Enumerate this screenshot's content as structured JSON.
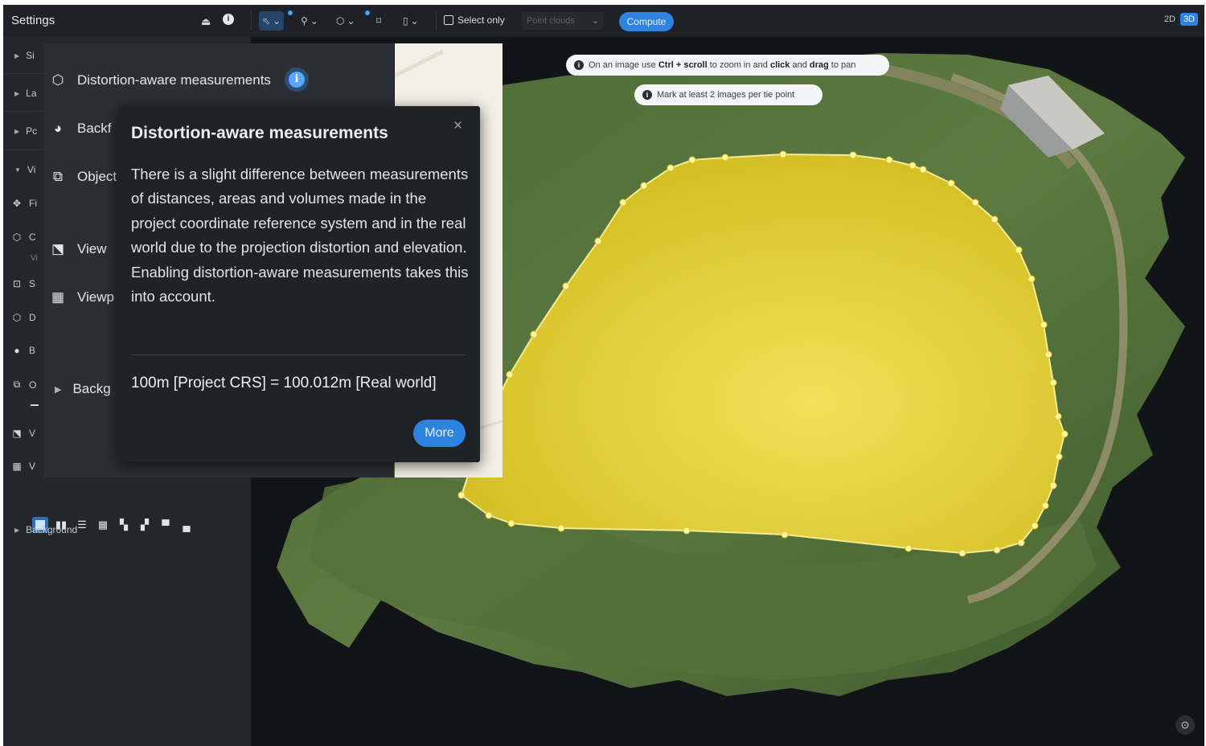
{
  "toolbar": {
    "settings_title": "Settings",
    "select_only_label": "Select only",
    "point_clouds_placeholder": "Point clouds",
    "compute_label": "Compute",
    "view_2d": "2D",
    "view_3d": "3D"
  },
  "sidebar": {
    "items": [
      {
        "label": "Si"
      },
      {
        "label": "La"
      },
      {
        "label": "Pc"
      },
      {
        "label": "Vi"
      },
      {
        "label": "Fi"
      },
      {
        "label": "C"
      },
      {
        "label": "Vi"
      },
      {
        "label": "S"
      },
      {
        "label": "D"
      },
      {
        "label": "B"
      },
      {
        "label": "O"
      },
      {
        "label": "V"
      },
      {
        "label": "V"
      }
    ],
    "background_label": "Background"
  },
  "panel": {
    "distortion_label": "Distortion-aware measurements",
    "backface_label": "Backf",
    "objects_label": "Object",
    "view_label": "View",
    "viewport_label": "Viewp",
    "background_label": "Backg",
    "distortion_enabled": true
  },
  "popover": {
    "title": "Distortion-aware measurements",
    "body": "There is a slight difference between measurements of distances, areas and volumes made in the project coordinate reference system and in the real world due to the projection distortion and elevation. Enabling distortion-aware measurements takes this into account.",
    "formula": "100m [Project CRS] = 100.012m [Real world]",
    "more_label": "More",
    "close_glyph": "×"
  },
  "hints": {
    "zoom_pre": "On an image use ",
    "zoom_ctrl": "Ctrl + scroll",
    "zoom_mid": " to zoom in and ",
    "zoom_click": "click",
    "zoom_and": " and ",
    "zoom_drag": "drag",
    "zoom_post": " to pan",
    "tie_point": "Mark at least 2 images per tie point"
  },
  "colors": {
    "accent": "#2f83e0",
    "polygon_fill": "#f3de3c",
    "vertex": "#fff6a8"
  },
  "icons": [
    "upload-icon",
    "info-icon",
    "cursor-icon",
    "pin-icon",
    "cube-icon",
    "crop-icon",
    "ruler-icon",
    "checkbox-icon",
    "cube-outline-icon",
    "gear-icon",
    "layers-icon",
    "grid-icon",
    "close-icon",
    "recenter-icon"
  ]
}
